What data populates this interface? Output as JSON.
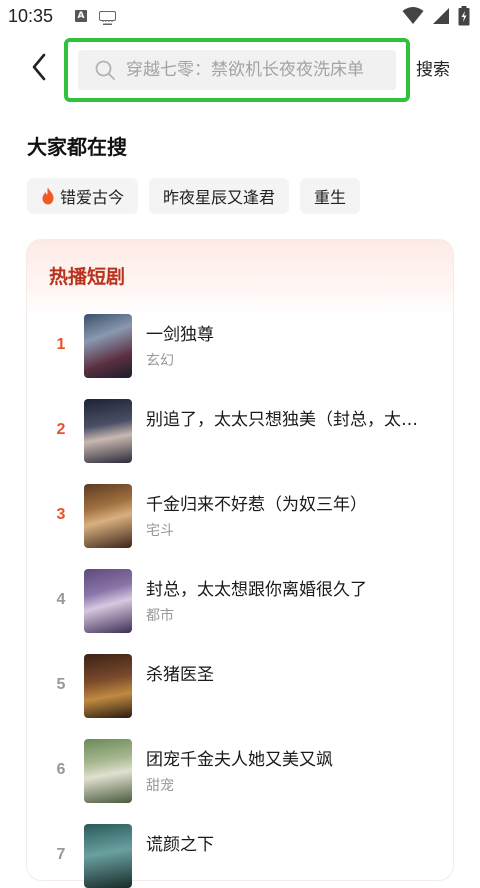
{
  "status_bar": {
    "time": "10:35",
    "icons": [
      "a-notification-icon",
      "keyboard-icon",
      "wifi-icon",
      "signal-icon",
      "battery-charging-icon"
    ]
  },
  "header": {
    "back_icon": "chevron-left-icon",
    "search_placeholder": "穿越七零：禁欲机长夜夜洗床单",
    "search_button": "搜索",
    "highlight_color": "#2fc23c"
  },
  "trending": {
    "title": "大家都在搜",
    "chips": [
      {
        "label": "错爱古今",
        "icon": "flame-icon"
      },
      {
        "label": "昨夜星辰又逢君"
      },
      {
        "label": "重生"
      }
    ]
  },
  "hot_dramas": {
    "title": "热播短剧",
    "accent_color": "#e6532a",
    "items": [
      {
        "rank": "1",
        "title": "一剑独尊",
        "tag": "玄幻"
      },
      {
        "rank": "2",
        "title": "别追了，太太只想独美（封总，太太想离婚）",
        "tag": ""
      },
      {
        "rank": "3",
        "title": "千金归来不好惹（为奴三年）",
        "tag": "宅斗"
      },
      {
        "rank": "4",
        "title": "封总，太太想跟你离婚很久了",
        "tag": "都市"
      },
      {
        "rank": "5",
        "title": "杀猪医圣",
        "tag": ""
      },
      {
        "rank": "6",
        "title": "团宠千金夫人她又美又飒",
        "tag": "甜宠"
      },
      {
        "rank": "7",
        "title": "谎颜之下",
        "tag": ""
      }
    ]
  }
}
